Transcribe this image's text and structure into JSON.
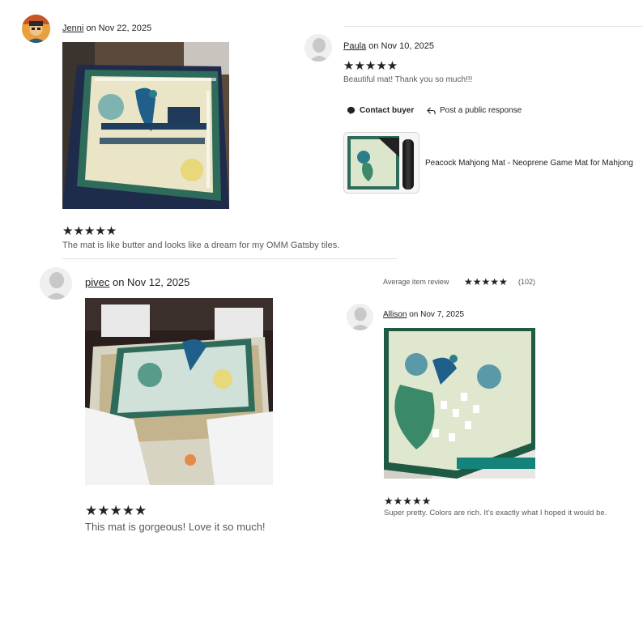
{
  "reviews": [
    {
      "reviewer": "Jenni",
      "date": "on Nov 22, 2025",
      "stars": "★★★★★",
      "text": "The mat is like butter and looks like a dream for my OMM Gatsby tiles."
    },
    {
      "reviewer": "Paula",
      "date": "on Nov 10, 2025",
      "stars": "★★★★★",
      "text": "Beautiful mat! Thank you so much!!!"
    },
    {
      "reviewer": "pivec",
      "date": "on Nov 12, 2025",
      "stars": "★★★★★",
      "text": "This mat is gorgeous! Love it so much!"
    },
    {
      "reviewer": "Allison",
      "date": "on Nov 7, 2025",
      "stars": "★★★★★",
      "text": "Super pretty. Colors are rich. It’s exactly what I hoped it would be."
    }
  ],
  "actions": {
    "contact_buyer": "Contact buyer",
    "public_response": "Post a public response"
  },
  "product": {
    "title": "Peacock Mahjong Mat - Neoprene Game Mat for Mahjong"
  },
  "average": {
    "label": "Average item review",
    "stars": "★★★★★",
    "count": "(102)"
  },
  "colors": {
    "star": "#222222",
    "muted_text": "#595959",
    "divider": "#e1e1e1",
    "mat_green": "#2f6b5a",
    "mat_cream": "#e9e5c6",
    "peacock_teal": "#2b7d8a"
  },
  "icons": [
    "user-avatar-icon",
    "chat-bubble-icon",
    "reply-arrow-icon",
    "star-icon"
  ]
}
